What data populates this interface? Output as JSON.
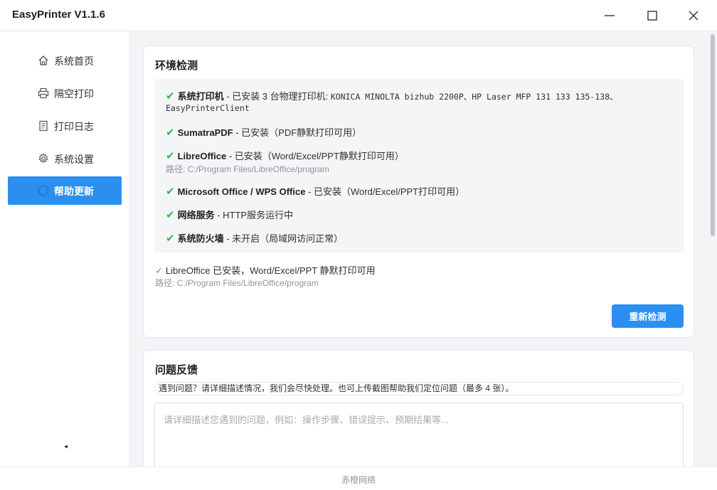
{
  "window": {
    "title": "EasyPrinter  V1.1.6",
    "controls": {
      "minimize": "minimize-icon",
      "maximize": "maximize-icon",
      "close": "close-icon"
    }
  },
  "sidebar": {
    "items": [
      {
        "label": "系统首页",
        "icon": "home-icon",
        "active": false
      },
      {
        "label": "隔空打印",
        "icon": "printer-icon",
        "active": false
      },
      {
        "label": "打印日志",
        "icon": "document-icon",
        "active": false
      },
      {
        "label": "系统设置",
        "icon": "gear-icon",
        "active": false
      },
      {
        "label": "帮助更新",
        "icon": "circle-icon",
        "active": true
      }
    ],
    "collapse_icon": "collapse-arrow-icon"
  },
  "env": {
    "title": "环境检测",
    "items": [
      {
        "name": "系统打印机",
        "status": " - 已安装 3 台物理打印机: ",
        "detail": "KONICA MINOLTA bizhub 2200P、HP Laser MFP 131 133 135-138、",
        "detail2": "EasyPrinterClient"
      },
      {
        "name": "SumatraPDF",
        "status": " - 已安装（PDF静默打印可用）"
      },
      {
        "name": "LibreOffice",
        "status": " - 已安装（Word/Excel/PPT静默打印可用）",
        "path": "路径: C:/Program Files/LibreOffice/program"
      },
      {
        "name": "Microsoft Office / WPS Office",
        "status": " - 已安装（Word/Excel/PPT打印可用）"
      },
      {
        "name": "网络服务",
        "status": " - HTTP服务运行中"
      },
      {
        "name": "系统防火墙",
        "status": " - 未开启（局域网访问正常）"
      }
    ],
    "check_mark": "✔",
    "summary_check": "✓",
    "summary": "LibreOffice 已安装，Word/Excel/PPT 静默打印可用",
    "summary_path": "路径: C:/Program Files/LibreOffice/program",
    "recheck_label": "重新检测"
  },
  "feedback": {
    "title": "问题反馈",
    "hint": "遇到问题？请详细描述情况，我们会尽快处理。也可上传截图帮助我们定位问题（最多 4 张）。",
    "placeholder": "请详细描述您遇到的问题，例如：操作步骤、错误提示、预期结果等...",
    "value": ""
  },
  "footer": {
    "text": "赤橙网络"
  },
  "colors": {
    "accent": "#2b8ff0",
    "success": "#3bb54a",
    "content_bg": "#f3f4f6"
  }
}
